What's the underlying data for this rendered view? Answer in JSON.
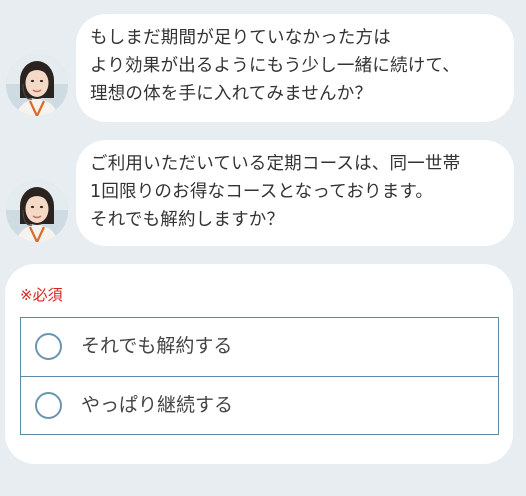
{
  "messages": [
    {
      "avatar": "operator-avatar",
      "lines": [
        "もしまだ期間が足りていなかった方は",
        "より効果が出るようにもう少し一緒に続けて、",
        "理想の体を手に入れてみませんか？"
      ]
    },
    {
      "avatar": "operator-avatar",
      "lines": [
        "ご利用いただいている定期コースは、同一世帯",
        "1回限りのお得なコースとなっております。",
        "それでも解約しますか？"
      ]
    }
  ],
  "form": {
    "required_label": "※必須",
    "options": [
      {
        "label": "それでも解約する",
        "selected": false
      },
      {
        "label": "やっぱり継続する",
        "selected": false
      }
    ]
  },
  "colors": {
    "background": "#e8edf1",
    "bubble": "#ffffff",
    "required": "#d9241e",
    "option_border": "#5a8aa6"
  }
}
